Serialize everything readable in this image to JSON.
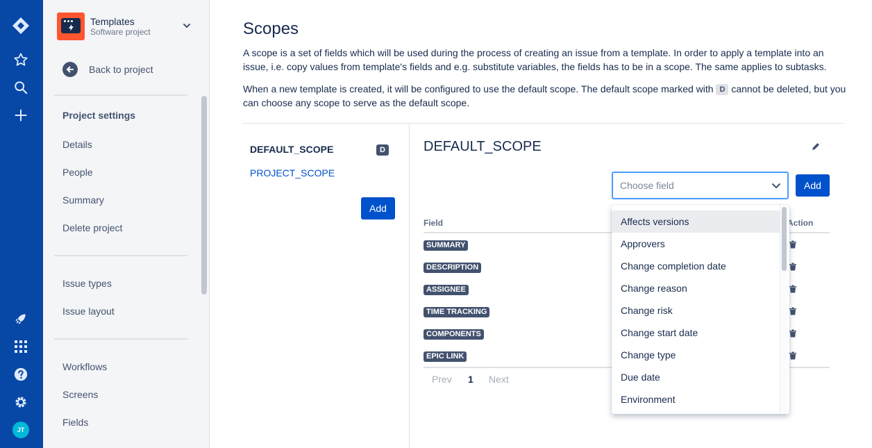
{
  "sidebar": {
    "project_name": "Templates",
    "project_type": "Software project",
    "back_label": "Back to project",
    "section_title": "Project settings",
    "items_group1": [
      "Details",
      "People",
      "Summary",
      "Delete project"
    ],
    "items_group2": [
      "Issue types",
      "Issue layout"
    ],
    "items_group3": [
      "Workflows",
      "Screens",
      "Fields"
    ]
  },
  "global_nav": {
    "avatar_initials": "JT",
    "icons": [
      "jira-logo-icon",
      "star-icon",
      "search-icon",
      "plus-icon",
      "rocket-icon",
      "apps-grid-icon",
      "help-icon",
      "gear-icon"
    ]
  },
  "main": {
    "title": "Scopes",
    "desc1": "A scope is a set of fields which will be used during the process of creating an issue from a template. In order to apply a template into an issue, i.e. copy values from template's fields and e.g. substitute variables, the fields has to be in a scope. The same applies to subtasks.",
    "desc2_before": "When a new template is created, it will be configured to use the default scope. The default scope marked with",
    "desc2_badge": "D",
    "desc2_after": "cannot be deleted, but you can choose any scope to serve as the default scope.",
    "scopes": [
      {
        "name": "DEFAULT_SCOPE",
        "badge": "D"
      },
      {
        "name": "PROJECT_SCOPE"
      }
    ],
    "add_scope_label": "Add",
    "detail_title": "DEFAULT_SCOPE",
    "field_select_placeholder": "Choose field",
    "add_field_label": "Add",
    "col_field": "Field",
    "col_action": "Action",
    "fields": [
      "SUMMARY",
      "DESCRIPTION",
      "ASSIGNEE",
      "TIME TRACKING",
      "COMPONENTS",
      "EPIC LINK"
    ],
    "pagination": {
      "prev": "Prev",
      "page": "1",
      "next": "Next"
    }
  },
  "dropdown": {
    "options": [
      "Affects versions",
      "Approvers",
      "Change completion date",
      "Change reason",
      "Change risk",
      "Change start date",
      "Change type",
      "Due date",
      "Environment"
    ],
    "highlighted": "Affects versions"
  },
  "colors": {
    "global_nav": "#0747A6",
    "primary": "#0052CC",
    "link": "#0052CC",
    "project_icon": "#FF5630"
  }
}
